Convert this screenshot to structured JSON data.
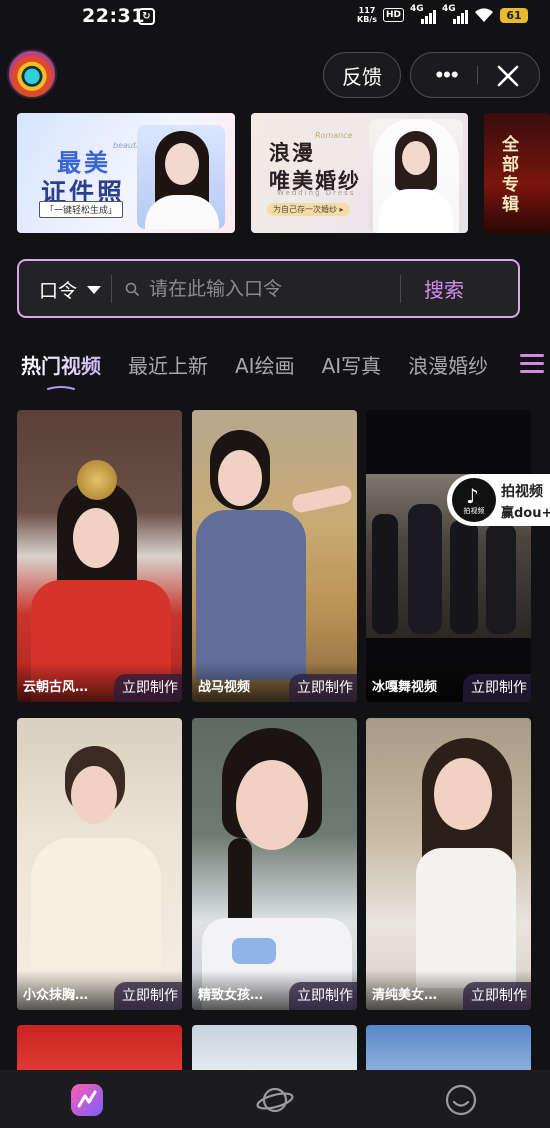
{
  "status_bar": {
    "time": "22:31",
    "net_speed_value": "117",
    "net_speed_unit": "KB/s",
    "hd_badge": "HD",
    "sim1_label": "4G",
    "sim2_label": "4G",
    "battery": "61"
  },
  "header": {
    "feedback_label": "反馈",
    "more_label": "•••"
  },
  "banners": [
    {
      "title_line1": "最美",
      "title_line2": "证件照",
      "subtitle": "「一键轻松生成」",
      "english": "beautiful photo"
    },
    {
      "title_line1": "浪漫",
      "title_line2": "唯美婚纱",
      "subtitle": "为自己存一次婚纱 ▸",
      "english": "Romance",
      "english2": "Wedding Dress"
    },
    {
      "title": "全部专辑"
    }
  ],
  "search": {
    "mode_label": "口令",
    "placeholder": "请在此输入口令",
    "button_label": "搜索"
  },
  "tabs": [
    "热门视频",
    "最近上新",
    "AI绘画",
    "AI写真",
    "浪漫婚纱"
  ],
  "cards": [
    {
      "name": "云朝古风…",
      "action": "立即制作"
    },
    {
      "name": "战马视频",
      "action": "立即制作"
    },
    {
      "name": "冰嘎舞视频",
      "action": "立即制作"
    },
    {
      "name": "小众抹胸…",
      "action": "立即制作"
    },
    {
      "name": "精致女孩…",
      "action": "立即制作"
    },
    {
      "name": "清纯美女…",
      "action": "立即制作"
    }
  ],
  "promo": {
    "line1": "拍视频",
    "line2": "赢dou+",
    "badge": "拍视频"
  },
  "colors": {
    "accent": "#d38ef0",
    "search_border": "#d9a8ea",
    "background": "#121214"
  },
  "icons": {
    "status_sync": "sync-icon",
    "wifi": "wifi-icon",
    "close": "close-icon",
    "search": "search-icon",
    "menu": "hamburger-menu-icon",
    "nav_home": "app-home-icon",
    "nav_discover": "planet-icon",
    "nav_profile": "smiley-face-icon"
  }
}
